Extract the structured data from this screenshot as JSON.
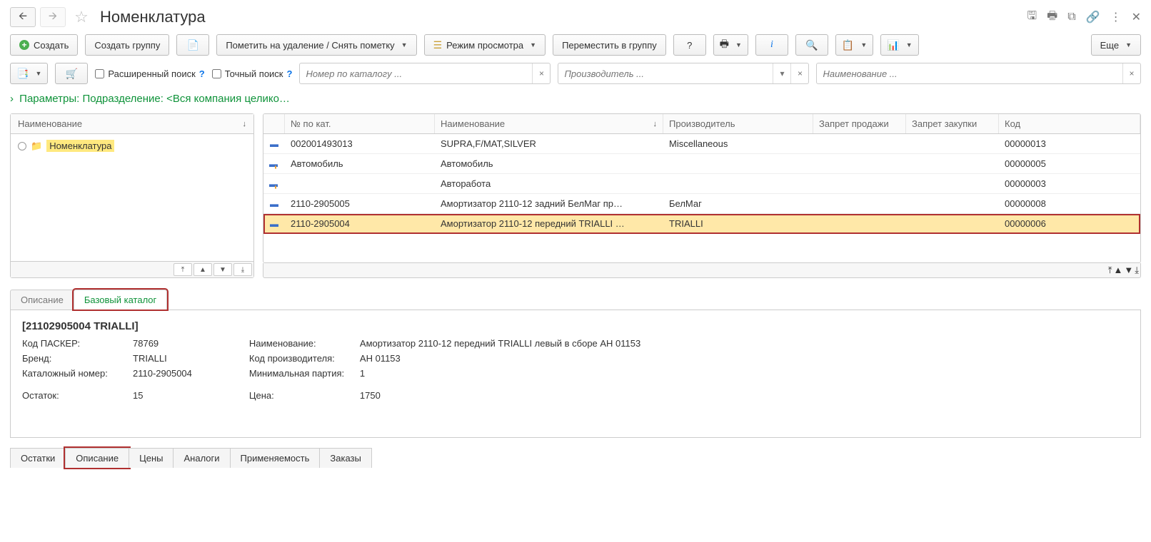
{
  "header": {
    "title": "Номенклатура"
  },
  "toolbar": {
    "create": "Создать",
    "create_group": "Создать группу",
    "mark_delete": "Пометить на удаление / Снять пометку",
    "view_mode": "Режим просмотра",
    "move_to_group": "Переместить в группу",
    "help": "?",
    "more": "Еще"
  },
  "filters": {
    "extended": "Расширенный поиск",
    "exact": "Точный поиск",
    "catalog_ph": "Номер по каталогу ...",
    "manufacturer_ph": "Производитель ...",
    "name_ph": "Наименование ..."
  },
  "params_link": "Параметры: Подразделение: <Вся компания целико…",
  "tree": {
    "col_name": "Наименование",
    "root": "Номенклатура"
  },
  "grid": {
    "cols": {
      "cat_no": "№ по кат.",
      "name": "Наименование",
      "manufacturer": "Производитель",
      "no_sale": "Запрет продажи",
      "no_buy": "Запрет закупки",
      "code": "Код"
    },
    "rows": [
      {
        "icon": "item",
        "cat": "002001493013",
        "name": "SUPRA,F/MAT,SILVER",
        "man": "Miscellaneous",
        "code": "00000013"
      },
      {
        "icon": "group",
        "cat": "Автомобиль",
        "name": "Автомобиль",
        "man": "",
        "code": "00000005"
      },
      {
        "icon": "group",
        "cat": "",
        "name": "Авторабота",
        "man": "",
        "code": "00000003"
      },
      {
        "icon": "item",
        "cat": "2110-2905005",
        "name": "Амортизатор 2110-12 задний БелМаг пр…",
        "man": "БелМаг",
        "code": "00000008"
      },
      {
        "icon": "item",
        "cat": "2110-2905004",
        "name": "Амортизатор 2110-12 передний TRIALLI …",
        "man": "TRIALLI",
        "code": "00000006",
        "selected": true
      }
    ]
  },
  "detail_tabs": {
    "description": "Описание",
    "base_catalog": "Базовый каталог"
  },
  "detail": {
    "title": "[21102905004 TRIALLI]",
    "left": {
      "pasker_k": "Код ПАСКЕР:",
      "pasker_v": "78769",
      "brand_k": "Бренд:",
      "brand_v": "TRIALLI",
      "catno_k": "Каталожный номер:",
      "catno_v": "2110-2905004",
      "stock_k": "Остаток:",
      "stock_v": "15"
    },
    "right": {
      "name_k": "Наименование:",
      "name_v": "Амортизатор 2110-12 передний TRIALLI левый в сборе AH 01153",
      "mancode_k": "Код производителя:",
      "mancode_v": "AH 01153",
      "minbatch_k": "Минимальная партия:",
      "minbatch_v": "1",
      "price_k": "Цена:",
      "price_v": "1750"
    }
  },
  "bottom_tabs": {
    "stocks": "Остатки",
    "description": "Описание",
    "prices": "Цены",
    "analogs": "Аналоги",
    "applicability": "Применяемость",
    "orders": "Заказы"
  }
}
